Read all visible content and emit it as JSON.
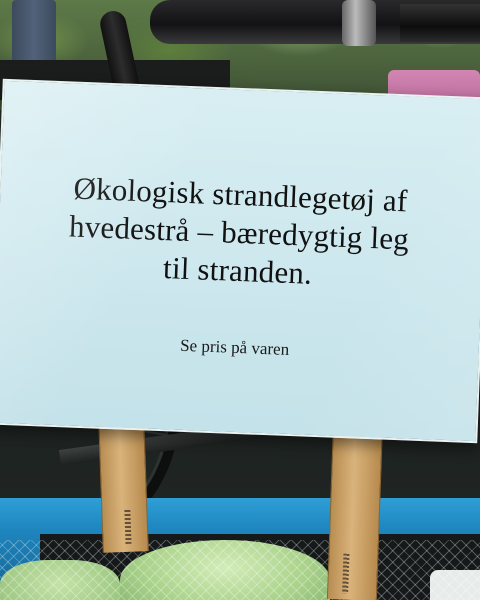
{
  "sign": {
    "headline_lines": [
      "Økologisk strandlegetøj af",
      "hvedestrå – bæredygtig leg",
      "til stranden."
    ],
    "price_note": "Se pris på varen"
  },
  "colors": {
    "sign_paper": "#cfe9ef",
    "text": "#111111",
    "stake_wood": "#d9b37b",
    "box_blue": "#1f86bf",
    "toy_green": "#a9d28a"
  }
}
